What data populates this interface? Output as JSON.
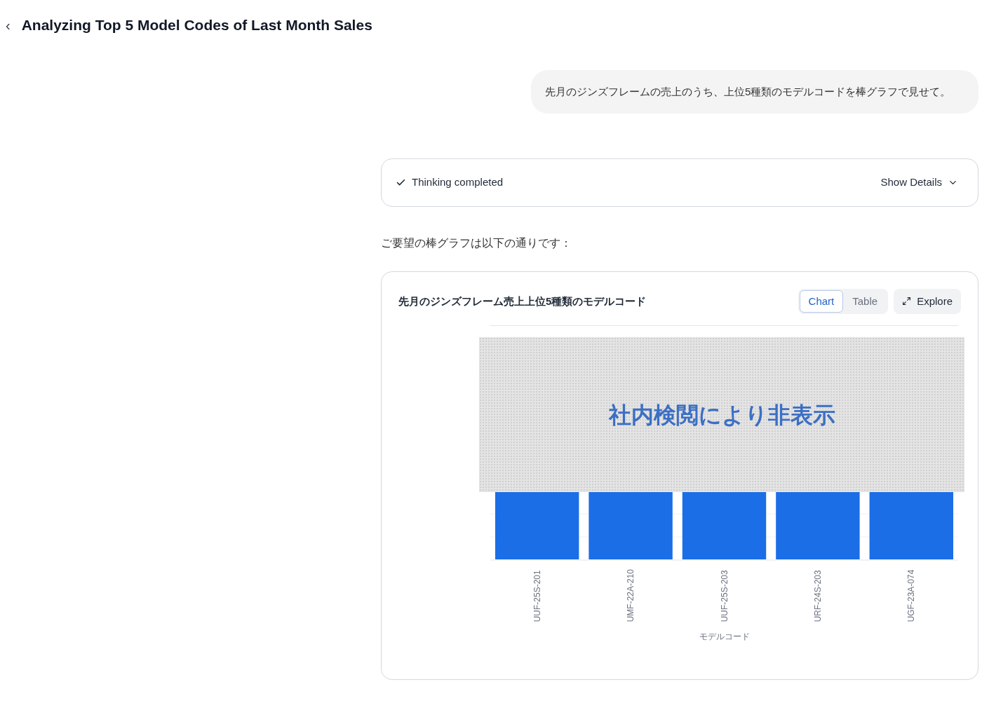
{
  "header": {
    "back": "‹",
    "title": "Analyzing Top 5 Model Codes of Last Month Sales"
  },
  "user_message": "先月のジンズフレームの売上のうち、上位5種類のモデルコードを棒グラフで見せて。",
  "thinking": {
    "status": "Thinking completed",
    "toggle": "Show Details",
    "expanded": false
  },
  "reply": "ご要望の棒グラフは以下の通りです：",
  "chart_card": {
    "title": "先月のジンズフレーム売上上位5種類のモデルコード",
    "tabs": [
      {
        "label": "Chart",
        "selected": true
      },
      {
        "label": "Table",
        "selected": false
      }
    ],
    "explore": "Explore",
    "overlay_text": "社内検閲により非表示",
    "x_labels": [
      "UUF-25S-201",
      "UMF-22A-210",
      "UUF-25S-203",
      "URF-24S-203",
      "UGF-23A-074"
    ],
    "xlabel": "モデルコード"
  }
}
